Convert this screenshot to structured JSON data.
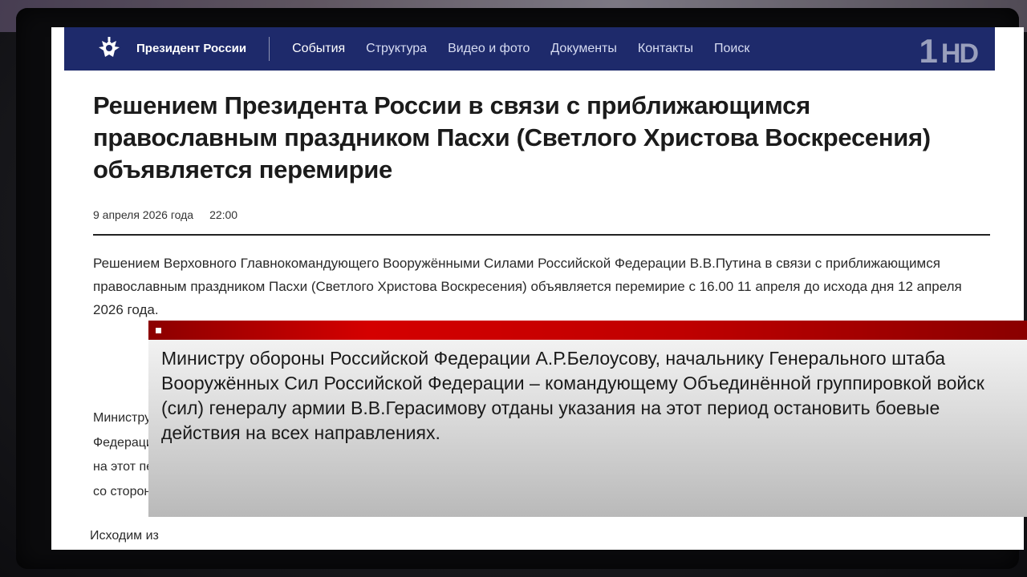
{
  "nav": {
    "site_name": "Президент России",
    "items": [
      "События",
      "Структура",
      "Видео и фото",
      "Документы",
      "Контакты",
      "Поиск"
    ]
  },
  "article": {
    "headline": "Решением Президента России в связи с приближающимся православным праздником Пасхи (Светлого Христова Воскресения) объявляется перемирие",
    "date": "9 апреля 2026 года",
    "time": "22:00",
    "lead": "Решением Верховного Главнокомандующего Вооружёнными Силами Российской Федерации В.В.Путина в связи с приближающимся православным праздником Пасхи (Светлого Христова Воскресения) объявляется перемирие с 16.00 11 апреля до исхода дня 12 апреля 2026 года.",
    "para2_lines": [
      "Министру с",
      "Федерации",
      "на этот пер",
      "со стороны"
    ],
    "para3": "Исходим из"
  },
  "overlay": {
    "channel_logo_num": "1",
    "channel_logo_hd": "HD",
    "caption": "Министру обороны Российской Федерации А.Р.Белоусову, начальнику Генерального штаба Вооружённых Сил Российской Федерации – командующему Объединённой группировкой войск (сил) генералу армии В.В.Герасимову отданы указания на этот период остановить боевые действия на всех направлениях."
  },
  "colors": {
    "nav_bg": "#1e2a6b",
    "banner_red": "#d40000"
  }
}
